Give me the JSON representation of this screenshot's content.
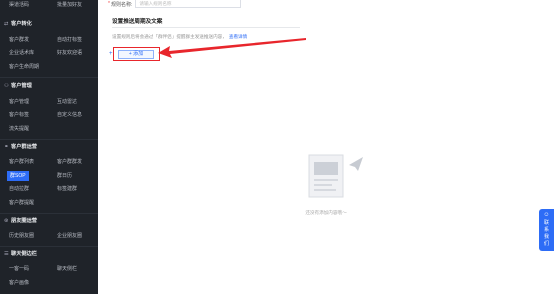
{
  "sidebar": {
    "top_items": [
      "渠道活码",
      "批量加好友"
    ],
    "groups": [
      {
        "title": "客户转化",
        "icon": "transfer-icon",
        "rows": [
          [
            "客户群发",
            "自动打标签"
          ],
          [
            "企业话术库",
            "好友欢迎语"
          ],
          [
            "客户生命周期"
          ]
        ]
      },
      {
        "title": "客户管理",
        "icon": "user-icon",
        "rows": [
          [
            "客户管理",
            "互动雷达"
          ],
          [
            "客户标签",
            "自定义信息"
          ],
          [
            "流失提醒"
          ]
        ]
      },
      {
        "title": "客户群运营",
        "icon": "group-icon",
        "rows": [
          [
            "客户群列表",
            "客户群群发"
          ],
          [
            "群SOP",
            "群日历"
          ],
          [
            "自动拉群",
            "标签建群"
          ],
          [
            "客户群提醒"
          ]
        ]
      },
      {
        "title": "朋友圈运营",
        "icon": "moments-icon",
        "rows": [
          [
            "历史朋友圈",
            "企业朋友圈"
          ]
        ]
      },
      {
        "title": "聊天侧边栏",
        "icon": "chat-sidebar-icon",
        "rows": [
          [
            "一客一码",
            "聊天侧栏"
          ],
          [
            "客户画像"
          ]
        ]
      }
    ],
    "active_item": "群SOP"
  },
  "form": {
    "rule_label": "规则名称:",
    "rule_placeholder": "请输入规则名称"
  },
  "section": {
    "title": "设置推送周期及文案",
    "description": "设置规则后将会通过「群伴侣」提醒群主发送推送内容，",
    "link_text": "查看详情",
    "add_button": "+ 添加"
  },
  "empty_state": {
    "text": "还没有添加内容哦～"
  },
  "float_widget": {
    "label": "联系我们"
  },
  "colors": {
    "sidebar_bg": "#1f2329",
    "accent": "#2d6cf6",
    "highlight": "#e8262c"
  }
}
